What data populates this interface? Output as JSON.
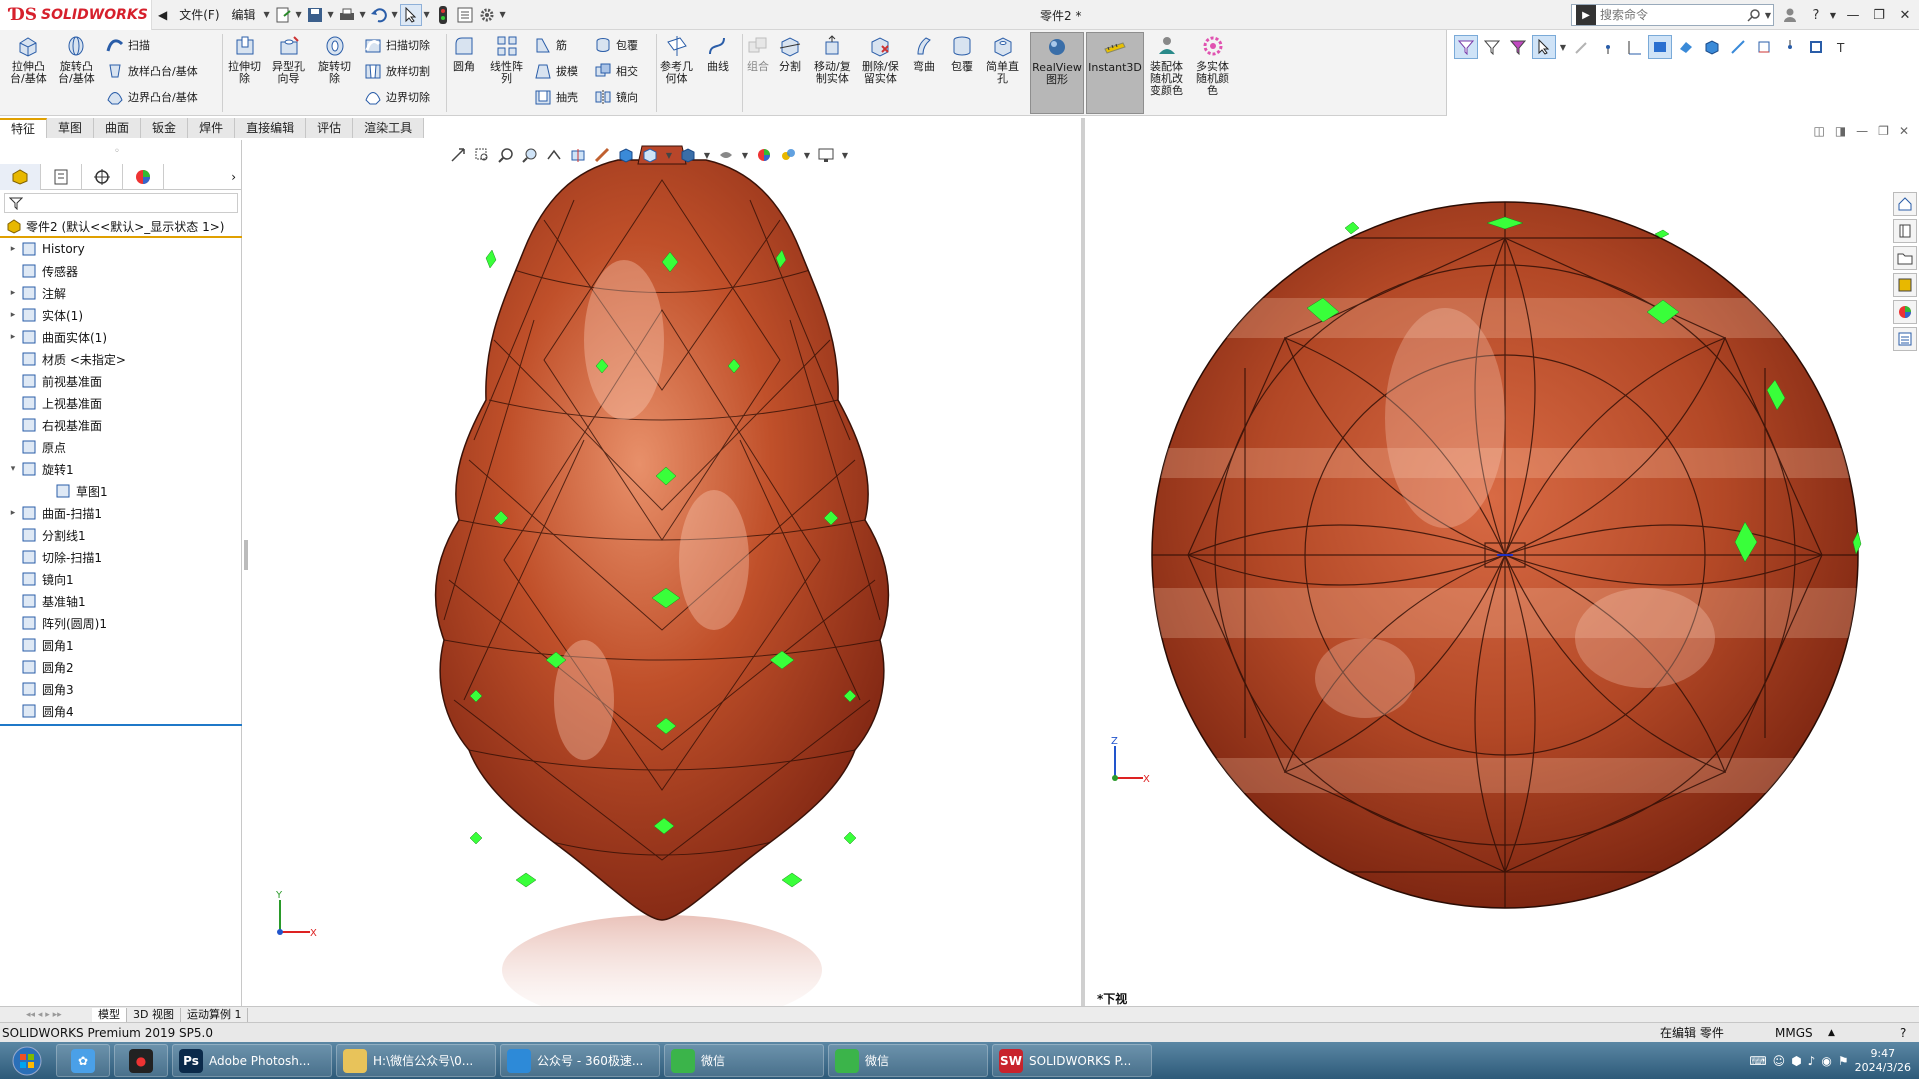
{
  "app": {
    "brand": "SOLIDWORKS",
    "document_title": "零件2 *",
    "menu_file": "文件(F)",
    "menu_edit": "编辑"
  },
  "search": {
    "placeholder": "搜索命令"
  },
  "ribbon": {
    "extrude_boss": "拉伸凸\n台/基体",
    "revolve_boss": "旋转凸\n台/基体",
    "sweep": "扫描",
    "loft_boss": "放样凸台/基体",
    "boundary_boss": "边界凸台/基体",
    "extrude_cut": "拉伸切\n除",
    "hole_wizard": "异型孔\n向导",
    "revolve_cut": "旋转切\n除",
    "swept_cut": "扫描切除",
    "lofted_cut": "放样切割",
    "boundary_cut": "边界切除",
    "fillet": "圆角",
    "linear_pattern": "线性阵\n列",
    "rib": "筋",
    "draft": "拔模",
    "shell": "抽壳",
    "wrap": "包覆",
    "intersect": "相交",
    "mirror": "镜向",
    "ref_geometry": "参考几\n何体",
    "curves": "曲线",
    "combine": "组合",
    "split": "分割",
    "move_copy": "移动/复\n制实体",
    "delete_keep": "删除/保\n留实体",
    "flex": "弯曲",
    "wrap2": "包覆",
    "simple_hole": "简单直\n孔",
    "realview": "RealView\n图形",
    "instant3d": "Instant3D",
    "assembly_color": "装配体\n随机改\n变颜色",
    "multibody_color": "多实体\n随机颜\n色"
  },
  "command_tabs": [
    "特征",
    "草图",
    "曲面",
    "钣金",
    "焊件",
    "直接编辑",
    "评估",
    "渲染工具"
  ],
  "feature_tree": {
    "root": "零件2 (默认<<默认>_显示状态 1>)",
    "items": [
      {
        "label": "History",
        "expand": "▸"
      },
      {
        "label": "传感器",
        "expand": ""
      },
      {
        "label": "注解",
        "expand": "▸"
      },
      {
        "label": "实体(1)",
        "expand": "▸"
      },
      {
        "label": "曲面实体(1)",
        "expand": "▸"
      },
      {
        "label": "材质 <未指定>",
        "expand": ""
      },
      {
        "label": "前视基准面",
        "expand": ""
      },
      {
        "label": "上视基准面",
        "expand": ""
      },
      {
        "label": "右视基准面",
        "expand": ""
      },
      {
        "label": "原点",
        "expand": ""
      },
      {
        "label": "旋转1",
        "expand": "▾"
      },
      {
        "label": "草图1",
        "expand": ""
      },
      {
        "label": "曲面-扫描1",
        "expand": "▸"
      },
      {
        "label": "分割线1",
        "expand": ""
      },
      {
        "label": "切除-扫描1",
        "expand": ""
      },
      {
        "label": "镜向1",
        "expand": ""
      },
      {
        "label": "基准轴1",
        "expand": ""
      },
      {
        "label": "阵列(圆周)1",
        "expand": ""
      },
      {
        "label": "圆角1",
        "expand": ""
      },
      {
        "label": "圆角2",
        "expand": ""
      },
      {
        "label": "圆角3",
        "expand": ""
      },
      {
        "label": "圆角4",
        "expand": ""
      }
    ]
  },
  "viewport": {
    "right_view_label": "*下视",
    "axis_x": "X",
    "axis_y": "Y",
    "axis_z": "Z"
  },
  "model_tabs": [
    "模型",
    "3D 视图",
    "运动算例 1"
  ],
  "status": {
    "product": "SOLIDWORKS Premium 2019 SP5.0",
    "editing": "在编辑 零件",
    "units": "MMGS"
  },
  "taskbar": {
    "items": [
      {
        "label": "Adobe Photosh...",
        "icon": "Ps",
        "color": "#0b2a4a"
      },
      {
        "label": "H:\\微信公众号\\0...",
        "icon": "",
        "color": "#e8c35a"
      },
      {
        "label": "公众号 - 360极速...",
        "icon": "",
        "color": "#2d8ad8"
      },
      {
        "label": "微信",
        "icon": "",
        "color": "#3bb44a"
      },
      {
        "label": "微信",
        "icon": "",
        "color": "#3bb44a"
      },
      {
        "label": "SOLIDWORKS P...",
        "icon": "SW",
        "color": "#c8232c"
      }
    ],
    "time": "9:47",
    "date": "2024/3/26"
  },
  "colors": {
    "wood_dark": "#8a2a14",
    "wood_mid": "#c0502a",
    "wood_light": "#e38862",
    "accent_green": "#39ff3a",
    "tab_accent": "#e0a000"
  }
}
